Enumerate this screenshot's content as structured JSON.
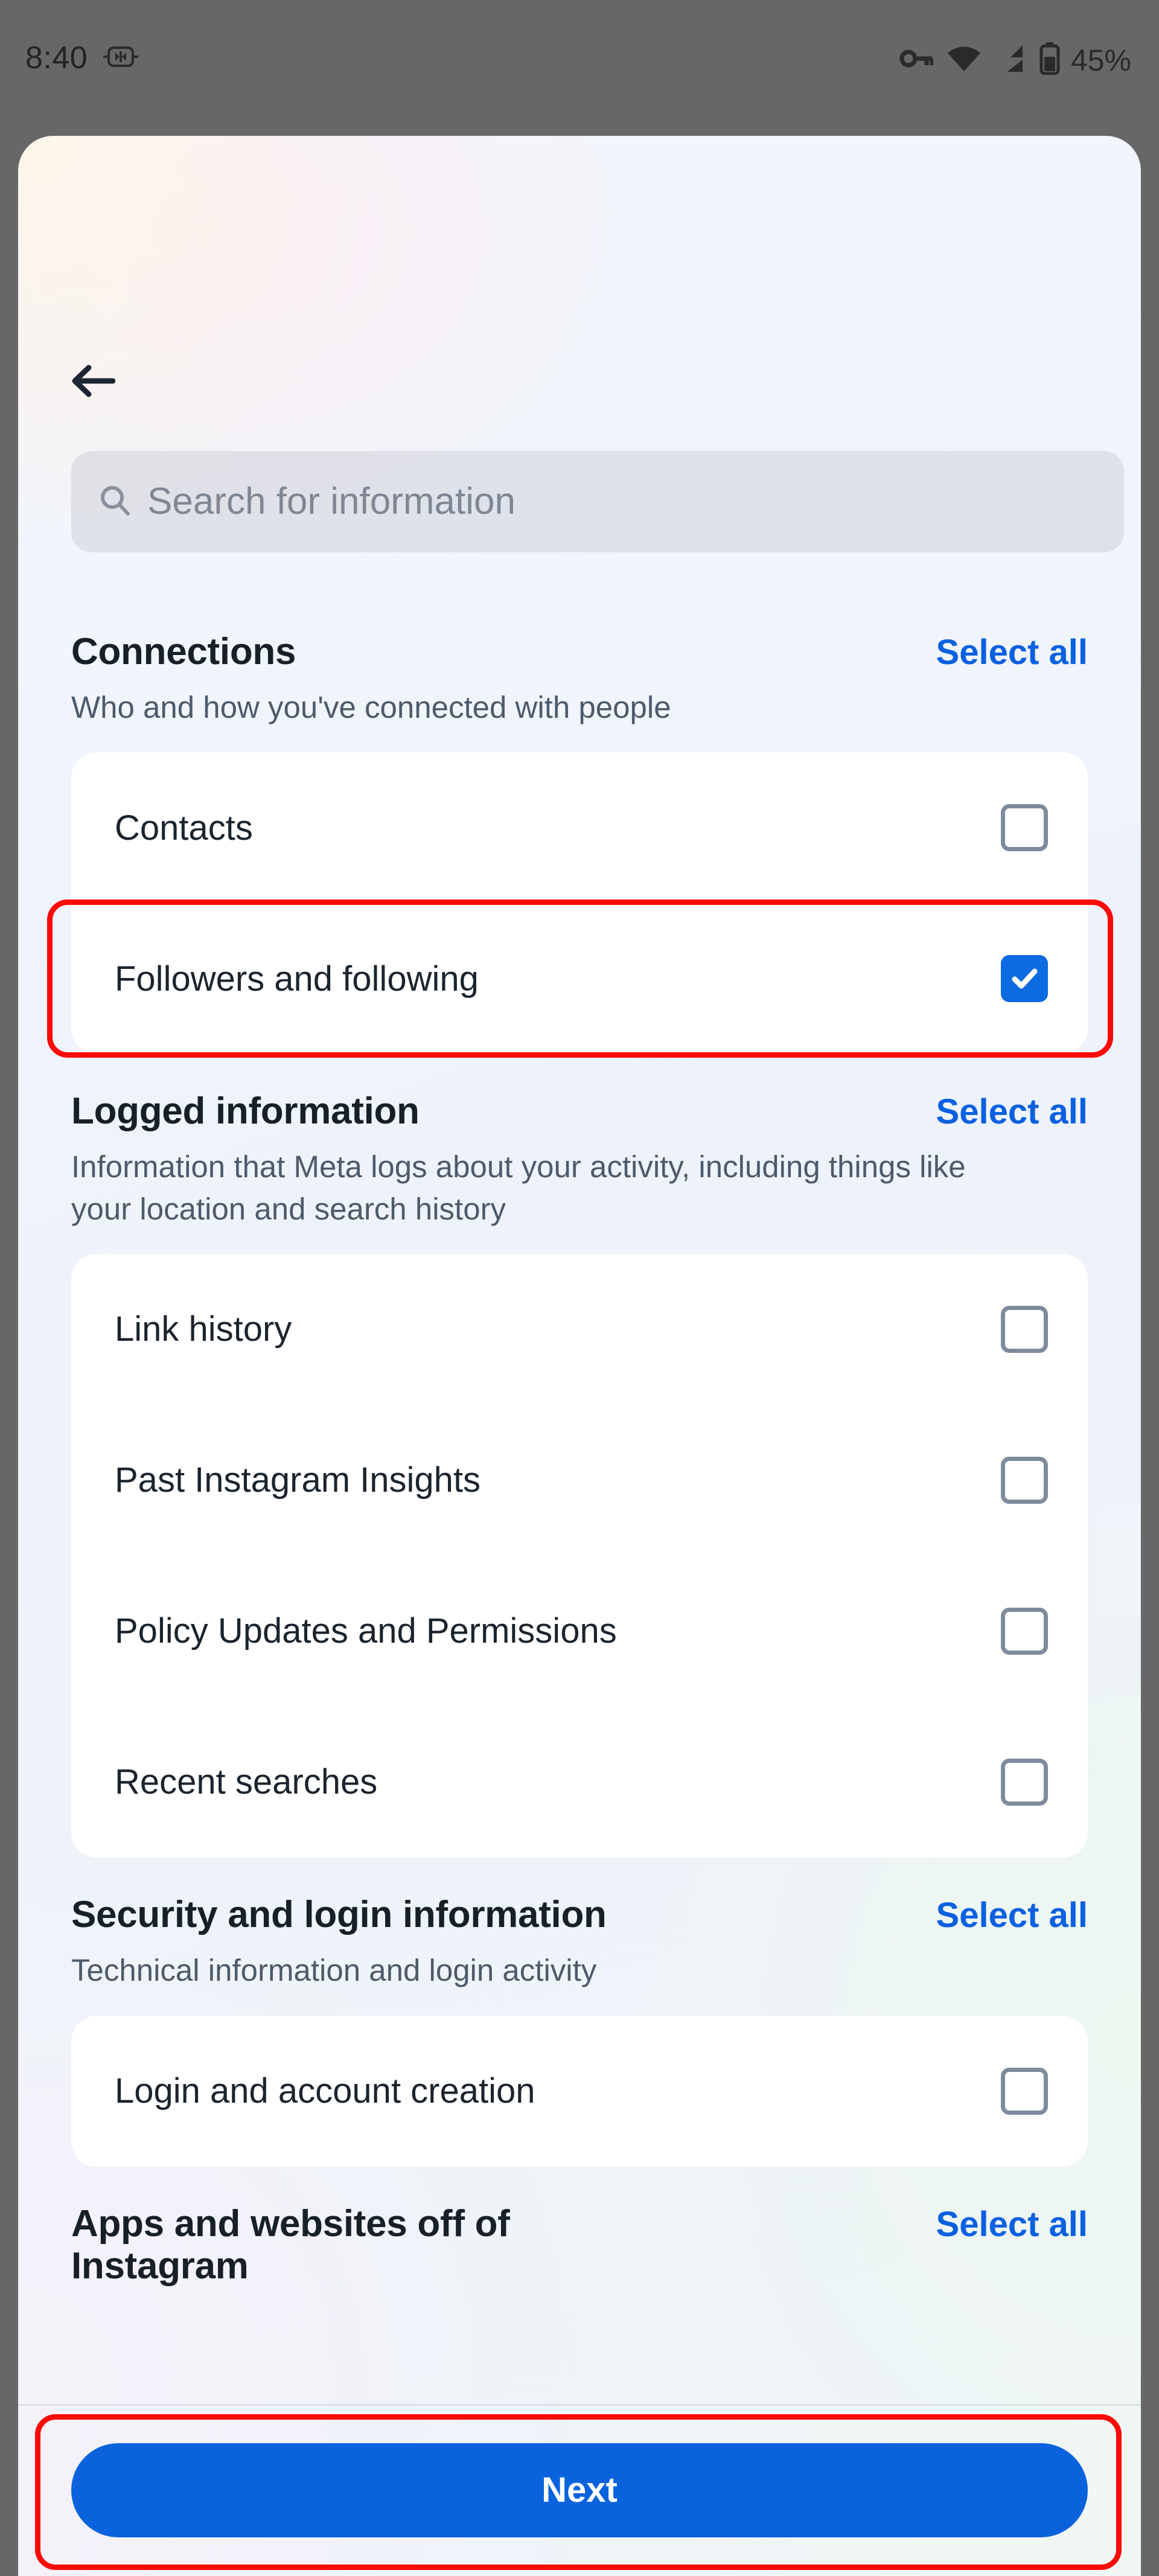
{
  "status_bar": {
    "time": "8:40",
    "icons": [
      "usb-debug-icon",
      "vpn-key-icon",
      "wifi-icon",
      "cellular-signal-icon",
      "battery-icon"
    ],
    "battery_percent": "45%"
  },
  "header": {
    "back_icon": "back-arrow-icon"
  },
  "search": {
    "icon": "search-icon",
    "placeholder": "Search for information",
    "value": ""
  },
  "select_all_label": "Select all",
  "sections": [
    {
      "title": "Connections",
      "subtitle": "Who and how you've connected with people",
      "select_all": "Select all",
      "items": [
        {
          "label": "Contacts",
          "checked": false
        },
        {
          "label": "Followers and following",
          "checked": true,
          "highlighted": true
        }
      ]
    },
    {
      "title": "Logged information",
      "subtitle": "Information that Meta logs about your activity, including things like your location and search history",
      "select_all": "Select all",
      "items": [
        {
          "label": "Link history",
          "checked": false
        },
        {
          "label": "Past Instagram Insights",
          "checked": false
        },
        {
          "label": "Policy Updates and Permissions",
          "checked": false
        },
        {
          "label": "Recent searches",
          "checked": false
        }
      ]
    },
    {
      "title": "Security and login information",
      "subtitle": "Technical information and login activity",
      "select_all": "Select all",
      "items": [
        {
          "label": "Login and account creation",
          "checked": false
        }
      ]
    },
    {
      "title": "Apps and websites off of Instagram",
      "subtitle": "",
      "select_all": "Select all",
      "items": []
    }
  ],
  "bottom_bar": {
    "next_label": "Next",
    "next_highlighted": true
  },
  "colors": {
    "accent_blue": "#0b62dd",
    "link_blue": "#0a60e0",
    "checkbox_checked": "#0c6be0",
    "checkbox_border": "#7e8b9c",
    "highlight_red": "#fb0a08",
    "title_text": "#172029",
    "subtitle_text": "#4d5a6a",
    "status_bar_bg": "#676767"
  }
}
